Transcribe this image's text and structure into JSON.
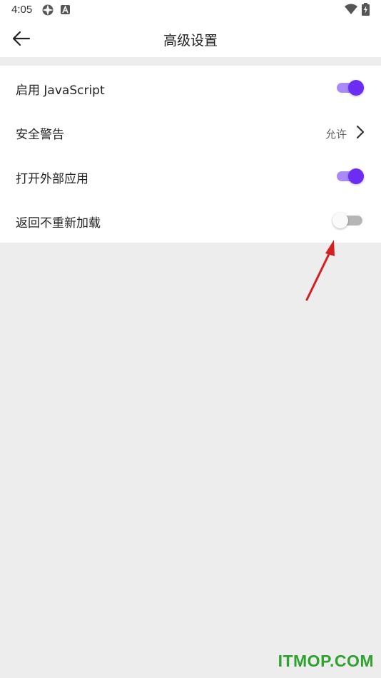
{
  "status_bar": {
    "time": "4:05",
    "icons": [
      "settings-gear-icon",
      "text-a-icon",
      "wifi-icon",
      "battery-charging-icon"
    ]
  },
  "header": {
    "title": "高级设置",
    "back_icon": "arrow-left-icon"
  },
  "settings": {
    "items": [
      {
        "label": "启用 JavaScript",
        "control": "toggle",
        "state": true
      },
      {
        "label": "安全警告",
        "control": "link",
        "value": "允许"
      },
      {
        "label": "打开外部应用",
        "control": "toggle",
        "state": true
      },
      {
        "label": "返回不重新加载",
        "control": "toggle",
        "state": false
      }
    ]
  },
  "annotation": {
    "icon": "red-arrow-icon",
    "color": "#e02020"
  },
  "watermark": {
    "text": "ITMOP.COM"
  },
  "colors": {
    "accent": "#6c2cf3",
    "accent_track": "#a98af7",
    "background": "#ededed",
    "watermark": "#2ea12e"
  }
}
